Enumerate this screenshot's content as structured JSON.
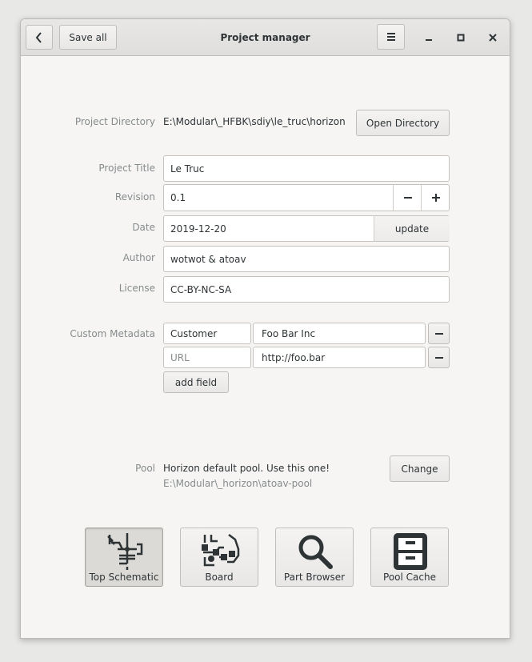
{
  "window": {
    "title": "Project manager",
    "back_icon": "chevron-left-icon",
    "save_all_label": "Save all",
    "menu_icon": "hamburger-menu-icon",
    "minimize_icon": "minimize-icon",
    "maximize_icon": "maximize-icon",
    "close_icon": "close-icon"
  },
  "directory": {
    "label": "Project Directory",
    "path": "E:\\Modular\\_HFBK\\sdiy\\le_truc\\horizon",
    "open_button": "Open Directory"
  },
  "fields": {
    "title_label": "Project Title",
    "title_value": "Le Truc",
    "revision_label": "Revision",
    "revision_value": "0.1",
    "date_label": "Date",
    "date_value": "2019-12-20",
    "date_update": "update",
    "author_label": "Author",
    "author_value": "wotwot & atoav",
    "license_label": "License",
    "license_value": "CC-BY-NC-SA"
  },
  "metadata": {
    "label": "Custom Metadata",
    "rows": [
      {
        "key": "Customer",
        "value": "Foo Bar Inc"
      },
      {
        "key": "URL",
        "value": "http://foo.bar"
      }
    ],
    "add_field": "add field"
  },
  "pool": {
    "label": "Pool",
    "name": "Horizon default pool. Use this one!",
    "path": "E:\\Modular\\_horizon\\atoav-pool",
    "change_button": "Change"
  },
  "tiles": [
    {
      "label": "Top Schematic",
      "icon": "schematic-icon",
      "active": true
    },
    {
      "label": "Board",
      "icon": "board-icon",
      "active": false
    },
    {
      "label": "Part Browser",
      "icon": "magnifier-icon",
      "active": false
    },
    {
      "label": "Pool Cache",
      "icon": "file-cabinet-icon",
      "active": false
    }
  ],
  "colors": {
    "window_bg": "#f6f5f4",
    "entry_bg": "#ffffff",
    "label_gray": "#868b8c",
    "text": "#2e3436"
  }
}
